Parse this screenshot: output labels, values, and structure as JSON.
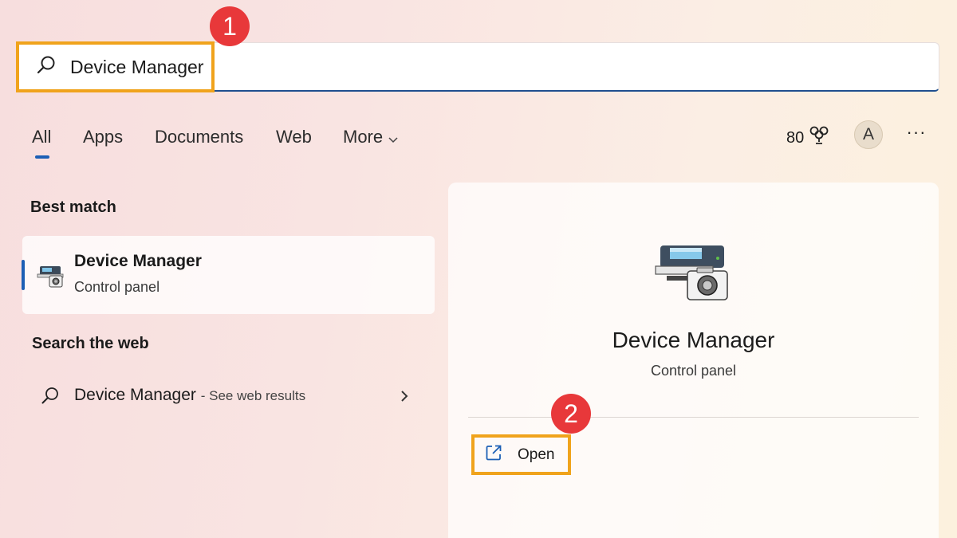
{
  "search": {
    "value": "Device Manager",
    "placeholder": ""
  },
  "callouts": [
    "1",
    "2"
  ],
  "tabs": [
    {
      "label": "All",
      "active": true
    },
    {
      "label": "Apps"
    },
    {
      "label": "Documents"
    },
    {
      "label": "Web"
    },
    {
      "label": "More"
    }
  ],
  "header": {
    "points": "80",
    "avatar_initial": "A",
    "more_glyph": "···"
  },
  "best_match": {
    "section_title": "Best match",
    "title": "Device Manager",
    "subtitle": "Control panel"
  },
  "search_web": {
    "section_title": "Search the web",
    "query": "Device Manager",
    "suffix": "- See web results"
  },
  "detail": {
    "title": "Device Manager",
    "subtitle": "Control panel",
    "open_label": "Open"
  },
  "colors": {
    "accent": "#1c5fb5",
    "highlight": "#f0a31c",
    "callout": "#e8383a"
  },
  "icons": {
    "search": "search-icon",
    "chevron": "chevron-down-icon",
    "trophy": "trophy-icon",
    "device_manager": "device-manager-icon",
    "open": "open-external-icon",
    "arrow": "chevron-right-icon"
  }
}
